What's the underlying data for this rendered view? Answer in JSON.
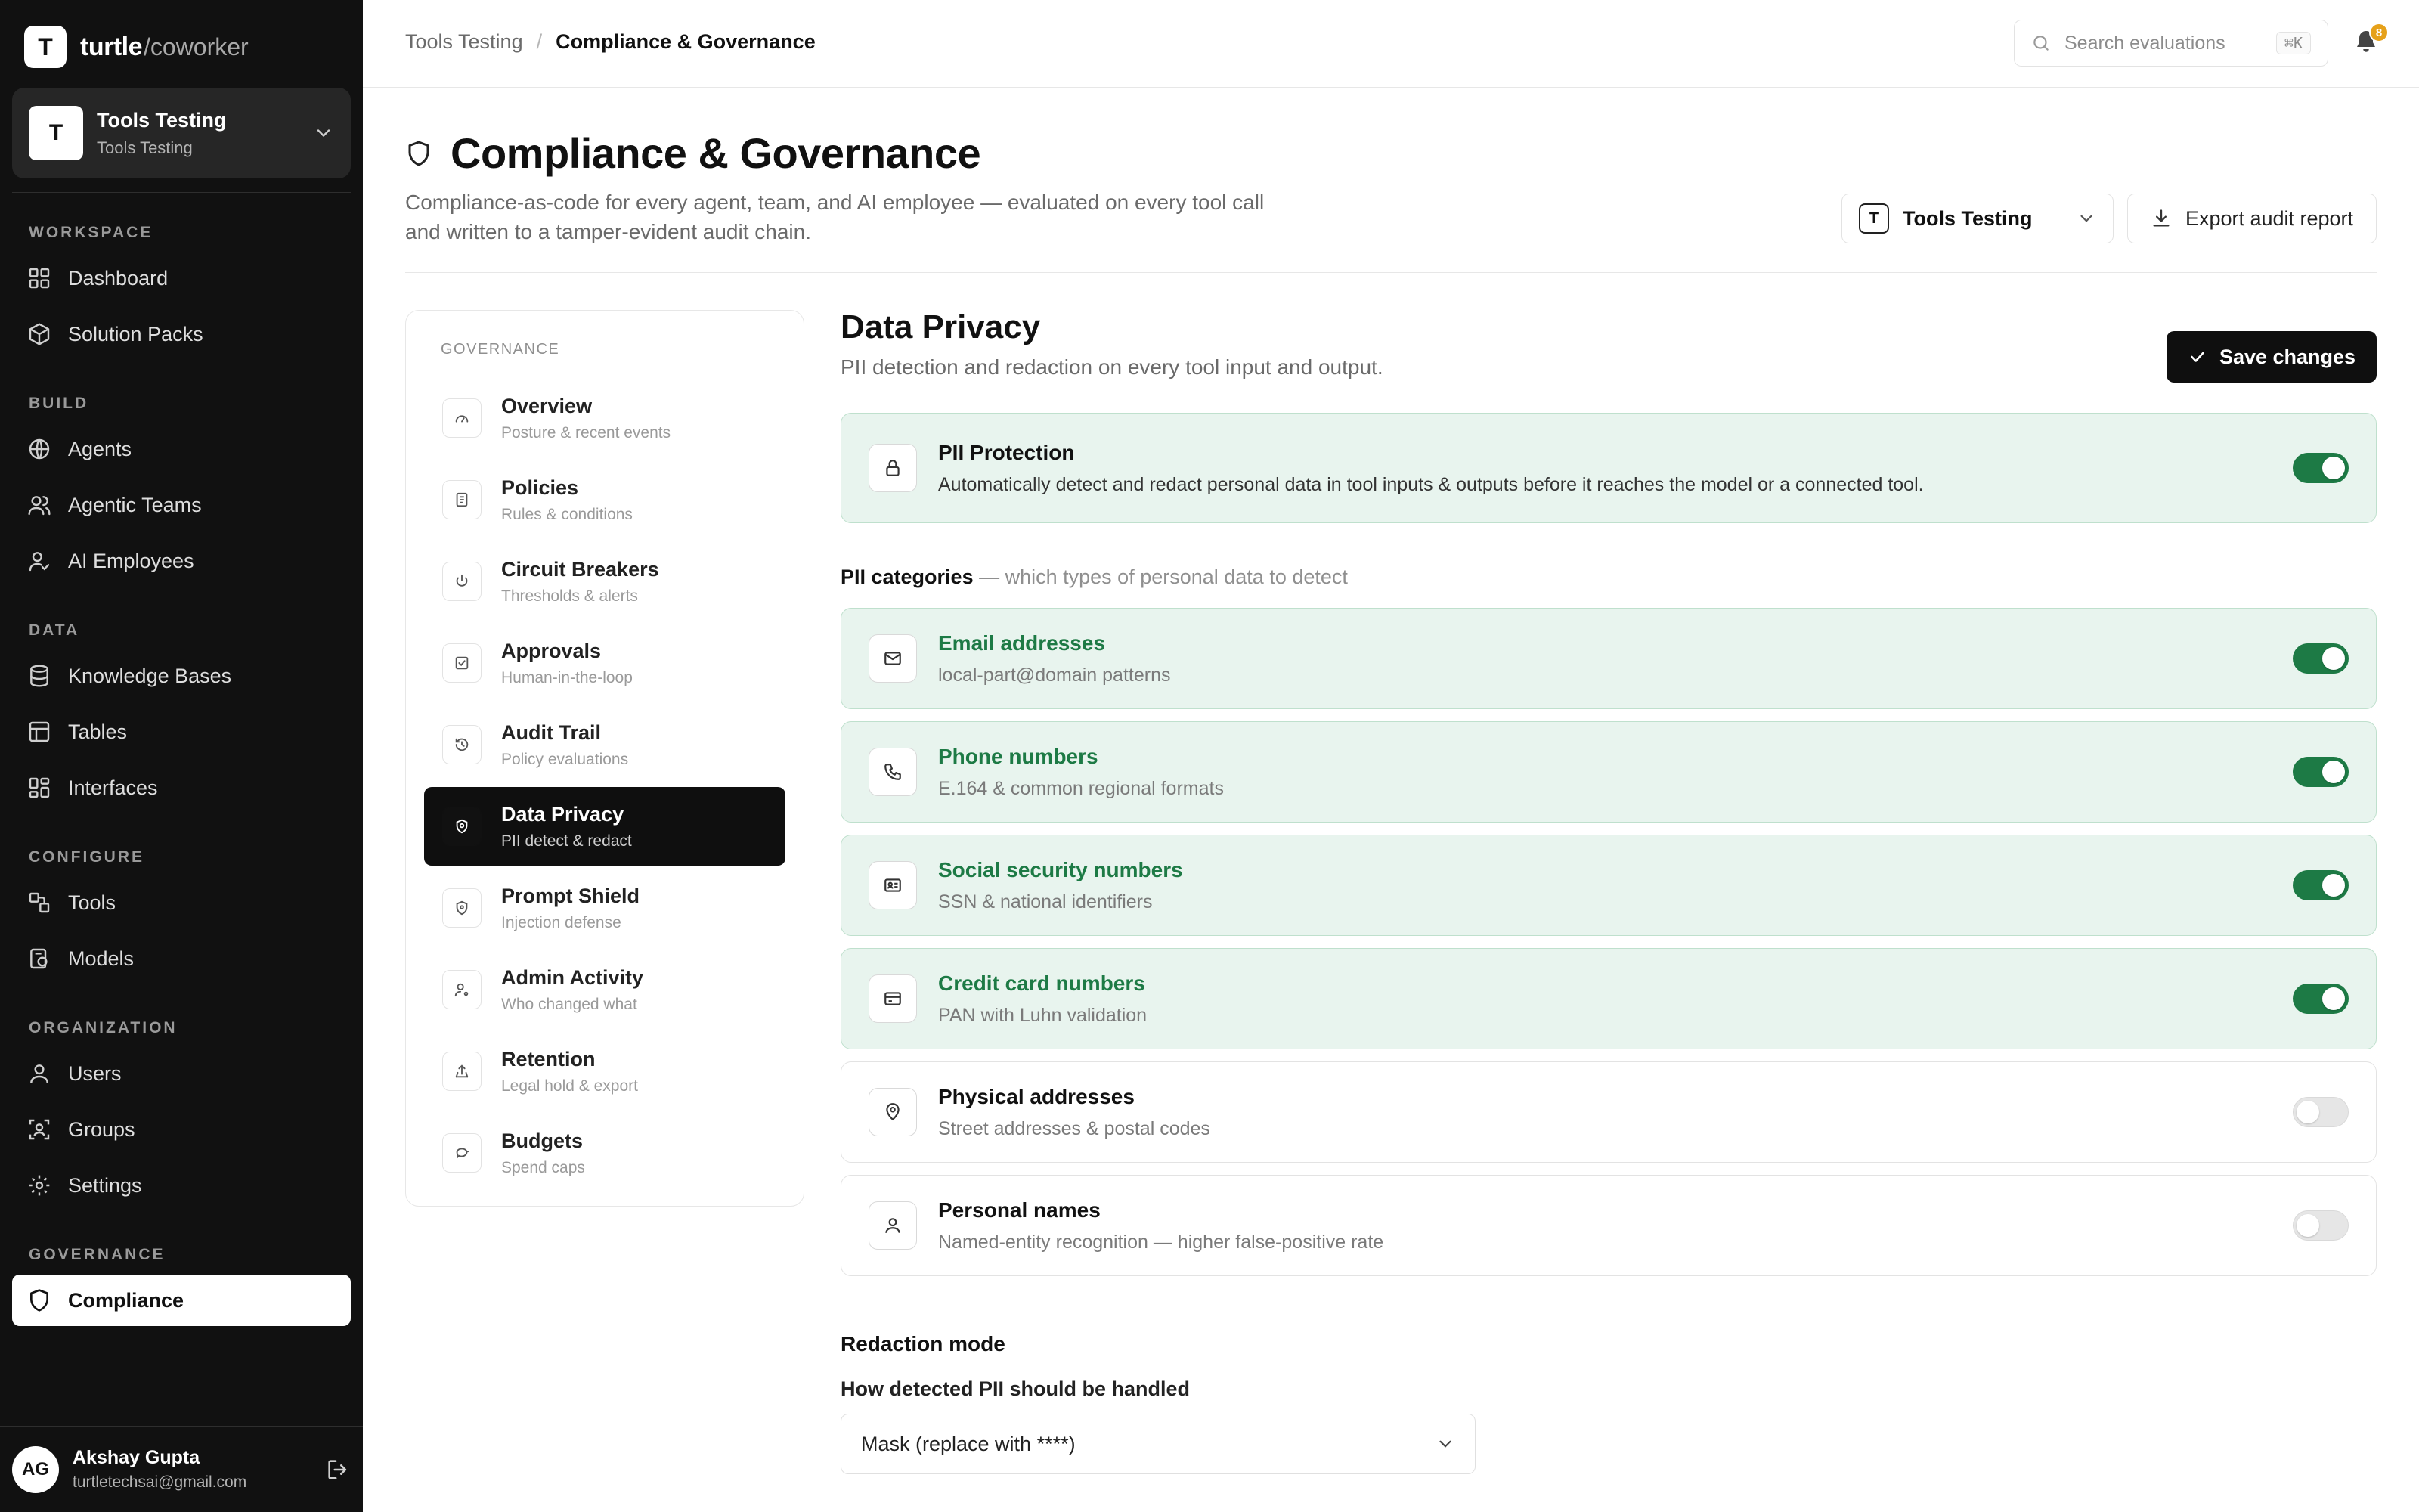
{
  "brand": {
    "logo": "T",
    "name": "turtle",
    "suffix": "/coworker"
  },
  "workspace": {
    "avatar": "T",
    "name": "Tools Testing",
    "subtitle": "Tools Testing"
  },
  "sidebar": {
    "sections": {
      "workspace": "WORKSPACE",
      "build": "BUILD",
      "data": "DATA",
      "configure": "CONFIGURE",
      "organization": "ORGANIZATION",
      "governance": "GOVERNANCE"
    },
    "items": {
      "dashboard": {
        "label": "Dashboard",
        "icon": "grid-icon"
      },
      "solution_packs": {
        "label": "Solution Packs",
        "icon": "box-icon"
      },
      "agents": {
        "label": "Agents",
        "icon": "globe-icon"
      },
      "agentic_teams": {
        "label": "Agentic Teams",
        "icon": "users-icon"
      },
      "ai_employees": {
        "label": "AI Employees",
        "icon": "user-check-icon"
      },
      "knowledge_bases": {
        "label": "Knowledge Bases",
        "icon": "database-icon"
      },
      "tables": {
        "label": "Tables",
        "icon": "table-icon"
      },
      "interfaces": {
        "label": "Interfaces",
        "icon": "layout-icon"
      },
      "tools": {
        "label": "Tools",
        "icon": "tools-icon"
      },
      "models": {
        "label": "Models",
        "icon": "model-icon"
      },
      "users": {
        "label": "Users",
        "icon": "user-icon"
      },
      "groups": {
        "label": "Groups",
        "icon": "group-icon"
      },
      "settings": {
        "label": "Settings",
        "icon": "gear-icon"
      },
      "compliance": {
        "label": "Compliance",
        "icon": "shield-icon"
      }
    }
  },
  "user": {
    "initials": "AG",
    "name": "Akshay Gupta",
    "email": "turtletechsai@gmail.com"
  },
  "topbar": {
    "breadcrumb": {
      "parent": "Tools Testing",
      "separator": "/",
      "current": "Compliance & Governance"
    },
    "search": {
      "placeholder": "Search evaluations",
      "shortcut": "⌘K"
    },
    "notifications": {
      "count": "8"
    }
  },
  "page": {
    "title": "Compliance & Governance",
    "description": "Compliance-as-code for every agent, team, and AI employee — evaluated on every tool call and written to a tamper-evident audit chain.",
    "scope": {
      "avatar": "T",
      "label": "Tools Testing"
    },
    "export_label": "Export audit report"
  },
  "governance_nav": {
    "heading": "GOVERNANCE",
    "items": [
      {
        "title": "Overview",
        "subtitle": "Posture & recent events",
        "icon": "gauge-icon"
      },
      {
        "title": "Policies",
        "subtitle": "Rules & conditions",
        "icon": "document-icon"
      },
      {
        "title": "Circuit Breakers",
        "subtitle": "Thresholds & alerts",
        "icon": "power-icon"
      },
      {
        "title": "Approvals",
        "subtitle": "Human-in-the-loop",
        "icon": "check-square-icon"
      },
      {
        "title": "Audit Trail",
        "subtitle": "Policy evaluations",
        "icon": "history-icon"
      },
      {
        "title": "Data Privacy",
        "subtitle": "PII detect & redact",
        "icon": "privacy-shield-icon"
      },
      {
        "title": "Prompt Shield",
        "subtitle": "Injection defense",
        "icon": "shield-alert-icon"
      },
      {
        "title": "Admin Activity",
        "subtitle": "Who changed what",
        "icon": "user-cog-icon"
      },
      {
        "title": "Retention",
        "subtitle": "Legal hold & export",
        "icon": "archive-icon"
      },
      {
        "title": "Budgets",
        "subtitle": "Spend caps",
        "icon": "piggy-bank-icon"
      }
    ]
  },
  "privacy": {
    "title": "Data Privacy",
    "subtitle": "PII detection and redaction on every tool input and output.",
    "save_label": "Save changes",
    "pii_protection": {
      "title": "PII Protection",
      "description": "Automatically detect and redact personal data in tool inputs & outputs before it reaches the model or a connected tool.",
      "enabled": true,
      "icon": "lock-icon"
    },
    "categories_heading": "PII categories",
    "categories_hint": "— which types of personal data to detect",
    "categories": [
      {
        "title": "Email addresses",
        "description": "local-part@domain patterns",
        "enabled": true,
        "icon": "mail-icon"
      },
      {
        "title": "Phone numbers",
        "description": "E.164 & common regional formats",
        "enabled": true,
        "icon": "phone-icon"
      },
      {
        "title": "Social security numbers",
        "description": "SSN & national identifiers",
        "enabled": true,
        "icon": "id-card-icon"
      },
      {
        "title": "Credit card numbers",
        "description": "PAN with Luhn validation",
        "enabled": true,
        "icon": "credit-card-icon"
      },
      {
        "title": "Physical addresses",
        "description": "Street addresses & postal codes",
        "enabled": false,
        "icon": "map-pin-icon"
      },
      {
        "title": "Personal names",
        "description": "Named-entity recognition — higher false-positive rate",
        "enabled": false,
        "icon": "person-icon"
      }
    ],
    "redaction": {
      "title": "Redaction mode",
      "label": "How detected PII should be handled",
      "selected": "Mask (replace with ****)"
    }
  },
  "colors": {
    "accent_green": "#1d7a45",
    "active_bg": "#0f0f0f",
    "sidebar_bg": "#111111",
    "badge": "#e6a11a"
  }
}
